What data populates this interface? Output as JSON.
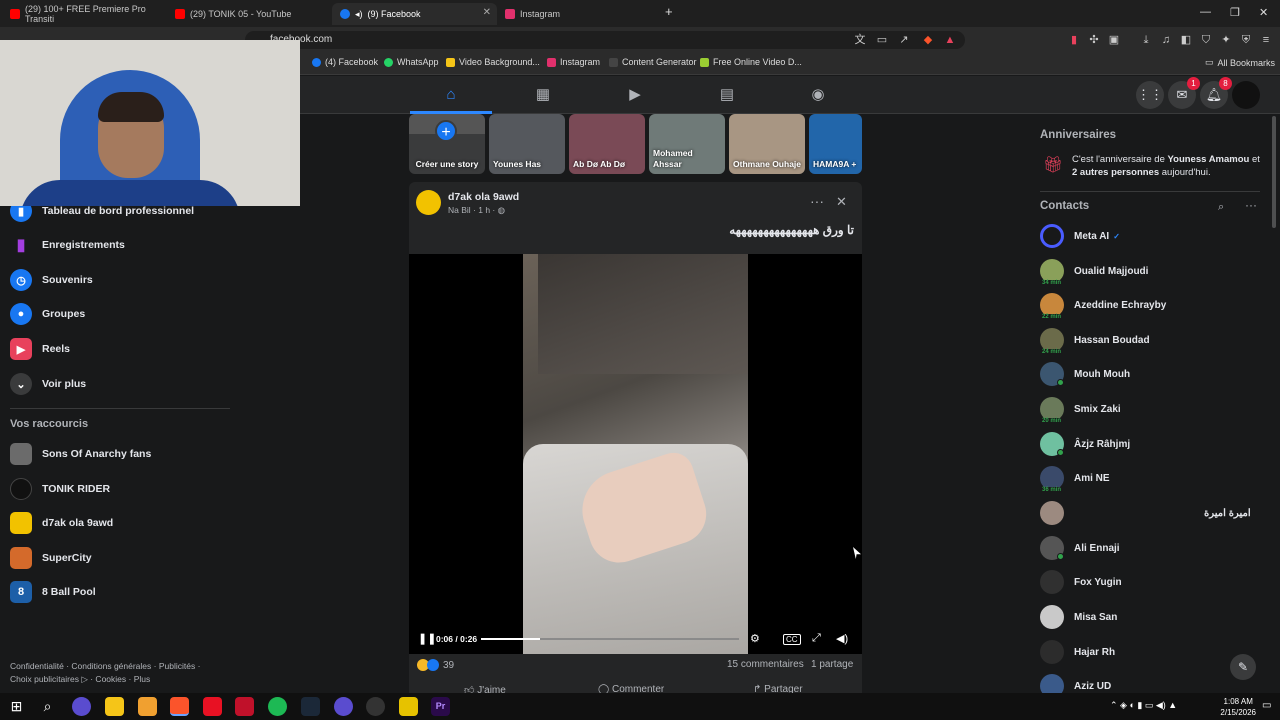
{
  "tabs": [
    {
      "label": "(29) 100+ FREE Premiere Pro Transiti",
      "favicon": "#ff0000"
    },
    {
      "label": "(29) TONIK 05 - YouTube",
      "favicon": "#ff0000"
    },
    {
      "label": "(9) Facebook",
      "favicon": "#1877f2",
      "active": true
    },
    {
      "label": "Instagram",
      "favicon": "#e1306c"
    }
  ],
  "address": {
    "url": "facebook.com"
  },
  "bookmarks": [
    {
      "label": "(4) Facebook",
      "color": "#1877f2"
    },
    {
      "label": "WhatsApp",
      "color": "#25d366"
    },
    {
      "label": "Video Background...",
      "color": "#f5c518"
    },
    {
      "label": "Instagram",
      "color": "#e1306c"
    },
    {
      "label": "Content Generator",
      "color": "#222222"
    },
    {
      "label": "Free Online Video D...",
      "color": "#9acd32"
    }
  ],
  "all_bookmarks": "All Bookmarks",
  "header": {
    "messenger_badge": "1",
    "notif_badge": "8"
  },
  "left_nav": [
    {
      "label": "Tableau de bord professionnel",
      "icon": "chart-icon",
      "color": "#1877f2"
    },
    {
      "label": "Enregistrements",
      "icon": "bookmark-icon",
      "color": "#a33ee0"
    },
    {
      "label": "Souvenirs",
      "icon": "clock-icon",
      "color": "#1877f2"
    },
    {
      "label": "Groupes",
      "icon": "groups-icon",
      "color": "#1877f2"
    },
    {
      "label": "Reels",
      "icon": "reels-icon",
      "color": "#e8415c"
    },
    {
      "label": "Voir plus",
      "icon": "chevron-down-icon",
      "color": "#3a3b3c"
    }
  ],
  "shortcuts_title": "Vos raccourcis",
  "shortcuts": [
    {
      "label": "Sons Of Anarchy fans",
      "color": "#6b6b6b"
    },
    {
      "label": "TONIK RIDER",
      "color": "#111111"
    },
    {
      "label": "d7ak ola 9awd",
      "color": "#f2c200"
    },
    {
      "label": "SuperCity",
      "color": "#d46a2b"
    },
    {
      "label": "8 Ball Pool",
      "color": "#1d5fa8"
    }
  ],
  "footer": {
    "line1": "Confidentialité · Conditions générales · Publicités ·",
    "line2": "Choix publicitaires ▷ · Cookies · Plus"
  },
  "stories": [
    {
      "label": "Créer une story",
      "color": "#3a3b3c"
    },
    {
      "label": "Younes Has",
      "color": "#55585d"
    },
    {
      "label": "Ab Dø Ab Dø",
      "color": "#7a4a56"
    },
    {
      "label": "Mohamed Ahssar",
      "color": "#6f7a78"
    },
    {
      "label": "Othmane Ouhaje",
      "color": "#a89683"
    },
    {
      "label": "HAMA9A +",
      "color": "#2266aa"
    }
  ],
  "post": {
    "author": "d7ak ola 9awd",
    "sub": "Na Bil · 1 h ·",
    "text": "تا ورق هههههههههههههههه",
    "video_time": "0:06 / 0:26",
    "video_progress": 0.23,
    "reactions": "39",
    "comments": "15 commentaires",
    "shares": "1 partage",
    "like": "J'aime",
    "comment": "Commenter",
    "share": "Partager"
  },
  "birthdays": {
    "title": "Anniversaires",
    "prefix": "C'est l'anniversaire de ",
    "name": "Youness Amamou",
    "mid": " et ",
    "others": "2 autres personnes",
    "suffix": " aujourd'hui."
  },
  "contacts_title": "Contacts",
  "contacts": [
    {
      "name": "Meta AI",
      "color": "#4a5cff",
      "status": ""
    },
    {
      "name": "Oualid Majjoudi",
      "color": "#8aa05a",
      "status": "34 min"
    },
    {
      "name": "Azeddine Echrayby",
      "color": "#c8873c",
      "status": "22 min"
    },
    {
      "name": "Hassan Boudad",
      "color": "#6b6b4a",
      "status": "24 min"
    },
    {
      "name": "Mouh Mouh",
      "color": "#3b5670",
      "status": "online"
    },
    {
      "name": "Smix Zaki",
      "color": "#6a7a5a",
      "status": "20 min"
    },
    {
      "name": "Âzjz Râhjmj",
      "color": "#6fc0a0",
      "status": "online"
    },
    {
      "name": "Ami NE",
      "color": "#3a4a6a",
      "status": "36 min"
    },
    {
      "name": "اميرة اميرة",
      "color": "#9c8a80",
      "status": ""
    },
    {
      "name": "Ali Ennaji",
      "color": "#555555",
      "status": "online"
    },
    {
      "name": "Fox Yugin",
      "color": "#303030",
      "status": ""
    },
    {
      "name": "Misa San",
      "color": "#c9c9c9",
      "status": ""
    },
    {
      "name": "Hajar Rh",
      "color": "#2c2c2c",
      "status": ""
    },
    {
      "name": "Aziz UD",
      "color": "#3a5a8a",
      "status": ""
    }
  ],
  "taskbar": {
    "time": "1:08 AM",
    "date": "2/15/2026"
  }
}
